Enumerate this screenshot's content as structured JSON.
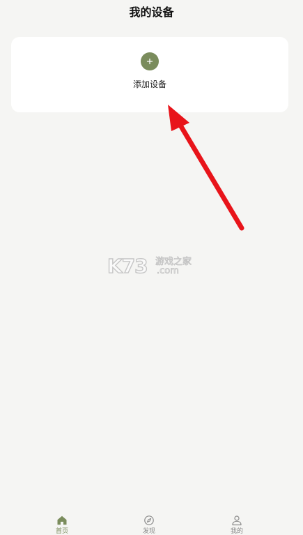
{
  "header": {
    "title": "我的设备"
  },
  "device_card": {
    "add_label": "添加设备"
  },
  "watermark": {
    "logo_text": "K73",
    "site_name": "游戏之家",
    "domain_suffix": ".com"
  },
  "tabbar": {
    "items": [
      {
        "label": "首页",
        "icon": "home-icon",
        "active": true
      },
      {
        "label": "发现",
        "icon": "compass-icon",
        "active": false
      },
      {
        "label": "我的",
        "icon": "user-icon",
        "active": false
      }
    ]
  },
  "colors": {
    "accent": "#7a8c5c",
    "background": "#f5f5f3",
    "card": "#ffffff",
    "arrow": "#e8141a",
    "inactive_tab": "#8a8a8a"
  }
}
